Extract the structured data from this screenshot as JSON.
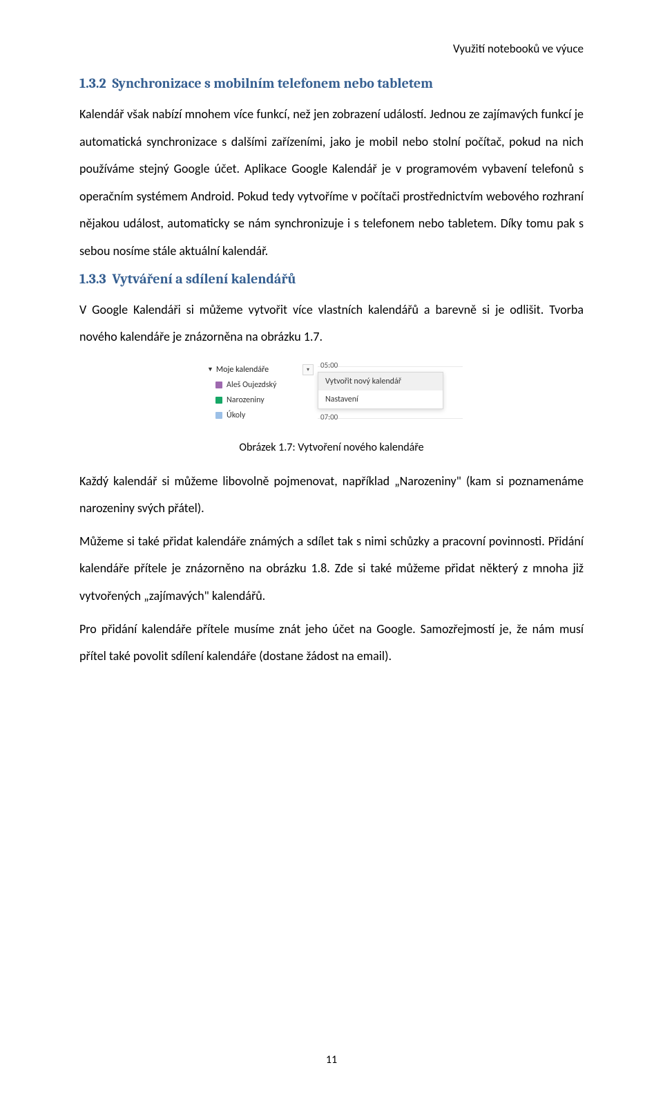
{
  "header": {
    "running_title": "Využití notebooků ve výuce"
  },
  "sections": {
    "s1": {
      "number": "1.3.2",
      "title": "Synchronizace s mobilním telefonem nebo tabletem",
      "p1": "Kalendář však nabízí mnohem více funkcí, než jen zobrazení událostí. Jednou ze zajímavých funkcí je automatická synchronizace s dalšími zařízeními, jako je mobil nebo stolní počítač, pokud na nich používáme stejný Google účet. Aplikace Google Kalendář je v programovém vybavení telefonů s operačním systémem Android. Pokud tedy vytvoříme v počítači prostřednictvím webového rozhraní nějakou událost, automaticky se nám synchronizuje i s telefonem nebo tabletem. Díky tomu pak s sebou nosíme stále aktuální kalendář."
    },
    "s2": {
      "number": "1.3.3",
      "title": "Vytváření a sdílení kalendářů",
      "p1": "V Google Kalendáři si můžeme vytvořit více vlastních kalendářů a barevně si je odlišit. Tvorba nového kalendáře je znázorněna na obrázku 1.7."
    }
  },
  "figure": {
    "sidebar_title": "Moje kalendáře",
    "items": [
      {
        "label": "Aleš Oujezdský",
        "color": "purple"
      },
      {
        "label": "Narozeniny",
        "color": "green"
      },
      {
        "label": "Úkoly",
        "color": "blue"
      }
    ],
    "times": {
      "t1": "05:00",
      "t2": "07:00"
    },
    "menu": {
      "m1": "Vytvořit nový kalendář",
      "m2": "Nastavení"
    },
    "caption": "Obrázek 1.7: Vytvoření nového kalendáře"
  },
  "after": {
    "p1": "Každý kalendář si můžeme libovolně pojmenovat, například „Narozeniny\" (kam si poznamenáme narozeniny svých přátel).",
    "p2": "Můžeme si také přidat kalendáře známých a sdílet tak s nimi schůzky a pracovní povinnosti. Přidání kalendáře přítele je znázorněno na obrázku 1.8. Zde si také můžeme přidat některý z mnoha již vytvořených „zajímavých\" kalendářů.",
    "p3": "Pro přidání kalendáře přítele musíme znát jeho účet na Google. Samozřejmostí je, že nám musí přítel také povolit sdílení kalendáře (dostane žádost na email)."
  },
  "page_number": "11"
}
